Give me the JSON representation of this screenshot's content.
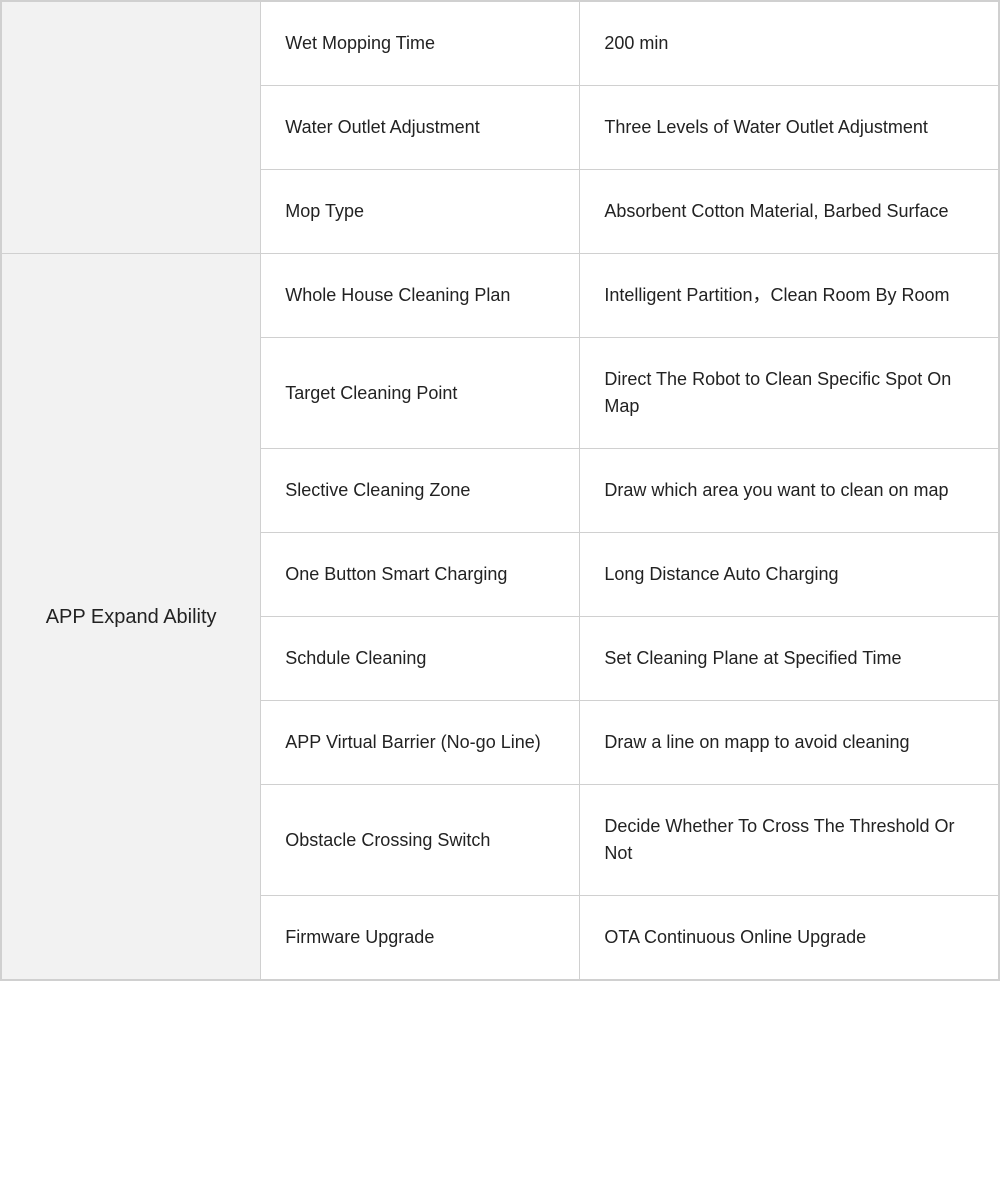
{
  "table": {
    "topRows": [
      {
        "feature": "Wet Mopping Time",
        "description": "200 min"
      },
      {
        "feature": "Water Outlet Adjustment",
        "description": "Three Levels of Water Outlet Adjustment"
      },
      {
        "feature": "Mop Type",
        "description": "Absorbent Cotton Material, Barbed Surface"
      }
    ],
    "appSection": {
      "categoryLabel": "APP Expand Ability",
      "rows": [
        {
          "feature": "Whole House Cleaning Plan",
          "description": "Intelligent Partition，Clean Room By Room"
        },
        {
          "feature": "Target Cleaning Point",
          "description": "Direct The Robot to Clean Specific Spot On Map"
        },
        {
          "feature": "Slective Cleaning Zone",
          "description": "Draw which area you want to clean on map"
        },
        {
          "feature": "One Button Smart Charging",
          "description": "Long Distance Auto Charging"
        },
        {
          "feature": "Schdule Cleaning",
          "description": "Set Cleaning Plane at Specified Time"
        },
        {
          "feature": "APP Virtual Barrier (No-go Line)",
          "description": "Draw a line on mapp to avoid cleaning"
        },
        {
          "feature": "Obstacle Crossing Switch",
          "description": "Decide Whether To Cross The Threshold Or Not"
        },
        {
          "feature": "Firmware Upgrade",
          "description": "OTA Continuous Online Upgrade"
        }
      ]
    }
  }
}
